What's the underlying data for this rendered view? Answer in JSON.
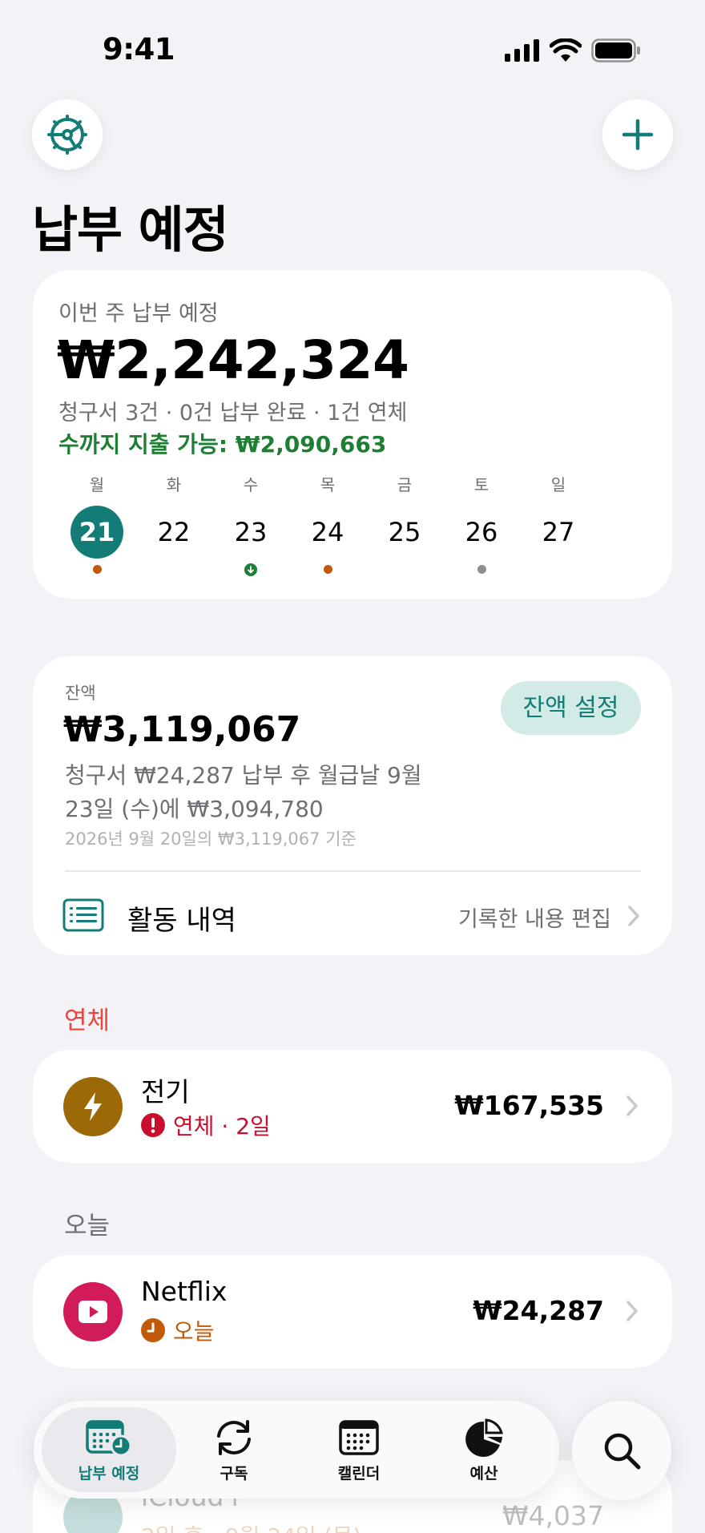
{
  "status_bar": {
    "time": "9:41"
  },
  "header": {
    "title": "납부 예정"
  },
  "week_summary": {
    "label": "이번 주 납부 예정",
    "amount": "₩2,242,324",
    "subtitle": "청구서 3건 · 0건 납부 완료 · 1건 연체",
    "spendable": "수까지 지출 가능: ₩2,090,663",
    "days": [
      {
        "dow": "월",
        "day": "21",
        "selected": true,
        "marker": "overdue"
      },
      {
        "dow": "화",
        "day": "22",
        "selected": false,
        "marker": "none"
      },
      {
        "dow": "수",
        "day": "23",
        "selected": false,
        "marker": "payday"
      },
      {
        "dow": "목",
        "day": "24",
        "selected": false,
        "marker": "due"
      },
      {
        "dow": "금",
        "day": "25",
        "selected": false,
        "marker": "none"
      },
      {
        "dow": "토",
        "day": "26",
        "selected": false,
        "marker": "scheduled"
      },
      {
        "dow": "일",
        "day": "27",
        "selected": false,
        "marker": "none"
      }
    ]
  },
  "balance": {
    "label": "잔액",
    "amount": "₩3,119,067",
    "button": "잔액 설정",
    "description": "청구서 ₩24,287 납부 후 월급날 9월 23일 (수)에 ₩3,094,780",
    "basis": "2026년 9월 20일의 ₩3,119,067 기준",
    "activity_label": "활동 내역",
    "activity_edit": "기록한 내용 편집"
  },
  "sections": {
    "overdue": {
      "title": "연체",
      "bill": {
        "name": "전기",
        "status": "연체 · 2일",
        "amount": "₩167,535",
        "icon": "lightning-icon"
      }
    },
    "today": {
      "title": "오늘",
      "bill": {
        "name": "Netflix",
        "status": "오늘",
        "amount": "₩24,287",
        "icon": "play-icon"
      }
    },
    "upcoming": {
      "bill": {
        "name": "iCloud+",
        "status": "2일 후 · 9월 24일 (목)",
        "amount": "₩4,037"
      }
    }
  },
  "tab_bar": {
    "tabs": [
      {
        "label": "납부 예정",
        "icon": "calendar-clock-icon",
        "active": true
      },
      {
        "label": "구독",
        "icon": "refresh-icon",
        "active": false
      },
      {
        "label": "캘린더",
        "icon": "calendar-icon",
        "active": false
      },
      {
        "label": "예산",
        "icon": "pie-chart-icon",
        "active": false
      }
    ]
  },
  "colors": {
    "accent": "#137c76",
    "overdue": "#c8102e",
    "today": "#c25a0a",
    "spendable": "#1e7e34",
    "section_overdue": "#e8453c"
  }
}
